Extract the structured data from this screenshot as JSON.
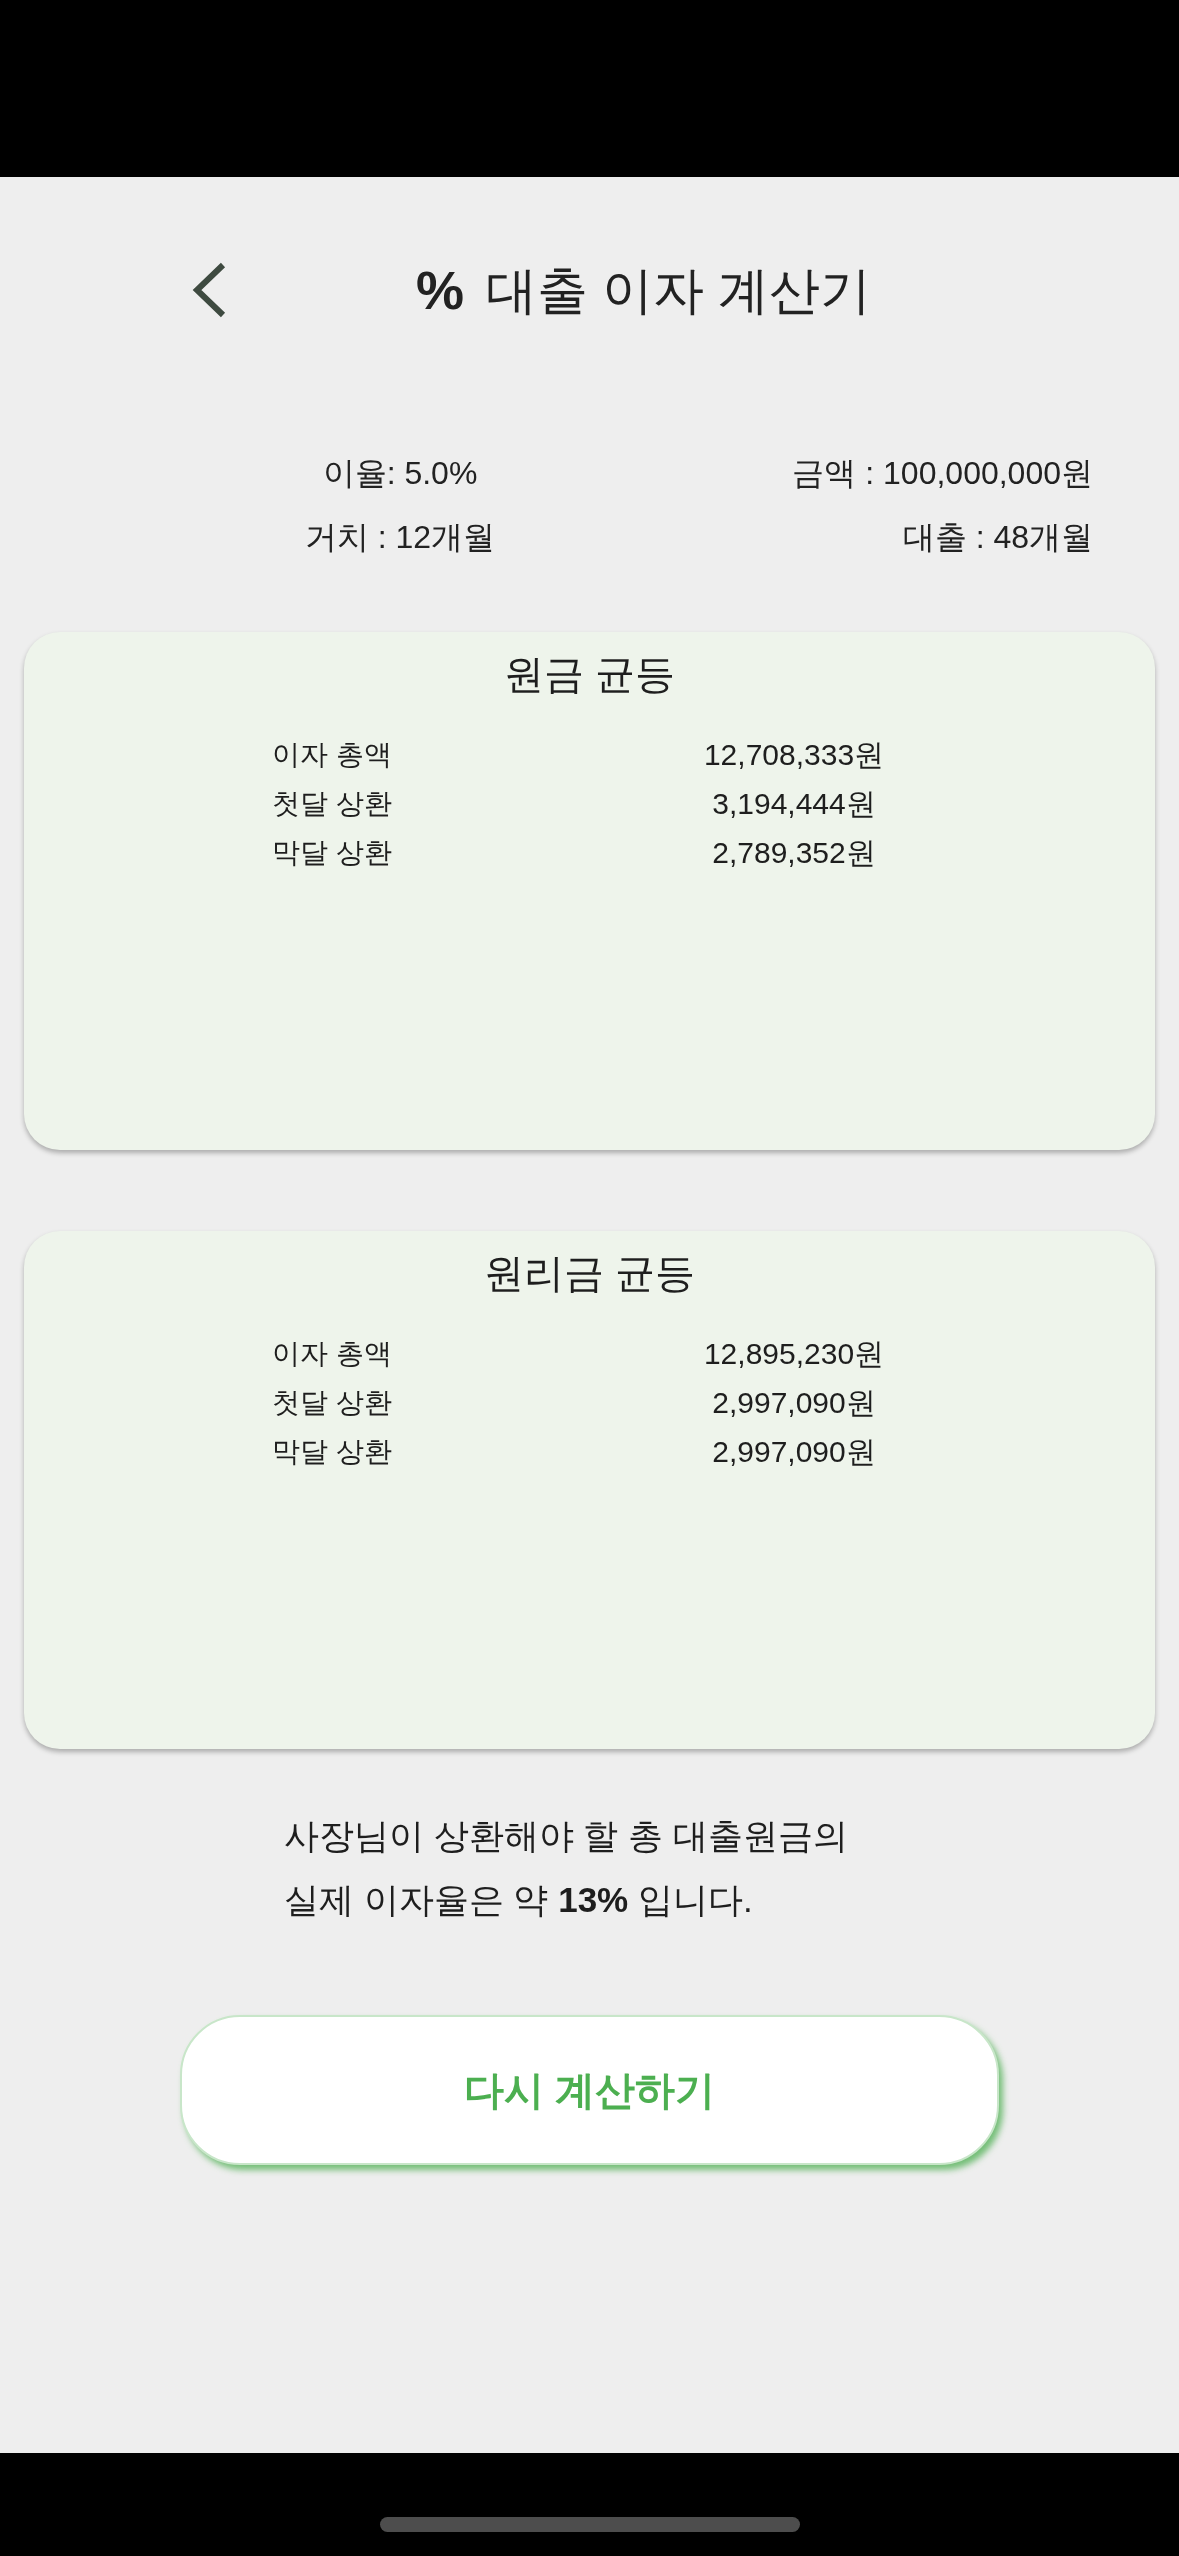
{
  "header": {
    "title_symbol": "%",
    "title": "대출 이자 계산기"
  },
  "loan_info": [
    {
      "text": "이율: 5.0%"
    },
    {
      "text": "금액 : 100,000,000원"
    },
    {
      "text": "거치 : 12개월"
    },
    {
      "text": "대출 : 48개월"
    }
  ],
  "plans": [
    {
      "title": "원금 균등",
      "rows": [
        {
          "label": "이자 총액",
          "value": "12,708,333원"
        },
        {
          "label": "첫달 상환",
          "value": "3,194,444원"
        },
        {
          "label": "막달 상환",
          "value": "2,789,352원"
        }
      ]
    },
    {
      "title": "원리금 균등",
      "rows": [
        {
          "label": "이자 총액",
          "value": "12,895,230원"
        },
        {
          "label": "첫달 상환",
          "value": "2,997,090원"
        },
        {
          "label": "막달 상환",
          "value": "2,997,090원"
        }
      ]
    }
  ],
  "summary": "사장님이 상환해야 할 총 대출원금의\n실제 이자율은 약 **13%** 입니다.",
  "button": {
    "label": "다시 계산하기"
  }
}
